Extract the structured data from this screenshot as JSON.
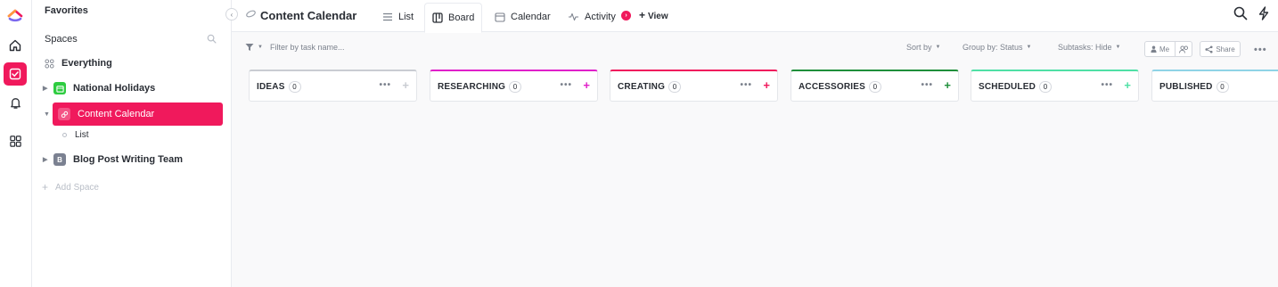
{
  "colors": {
    "accent": "#f0195c",
    "holidays_space": "#2ecc40",
    "blog_space": "#7b8191"
  },
  "rail": {
    "icons": [
      "clickup-logo-icon",
      "home-icon",
      "tasks-icon",
      "bell-icon",
      "apps-grid-icon"
    ]
  },
  "sidebar": {
    "favorites": "Favorites",
    "spaces": "Spaces",
    "everything": "Everything",
    "items": [
      {
        "label": "National Holidays"
      },
      {
        "label": "Content Calendar"
      },
      {
        "label": "Blog Post Writing Team",
        "badge": "B"
      }
    ],
    "list_child": "List",
    "add_space": "Add Space"
  },
  "header": {
    "title": "Content Calendar",
    "tabs": [
      {
        "label": "List"
      },
      {
        "label": "Board"
      },
      {
        "label": "Calendar"
      },
      {
        "label": "Activity"
      }
    ],
    "add_view": "View",
    "active_tab": "Board"
  },
  "toolbar": {
    "filter_placeholder": "Filter by task name...",
    "sort_by": "Sort by",
    "group_by": "Group by: Status",
    "subtasks": "Subtasks: Hide",
    "me": "Me",
    "share": "Share"
  },
  "board": {
    "columns": [
      {
        "name": "IDEAS",
        "count": "0",
        "color": "#c9ccd2"
      },
      {
        "name": "RESEARCHING",
        "count": "0",
        "color": "#e020c9"
      },
      {
        "name": "CREATING",
        "count": "0",
        "color": "#f0195c"
      },
      {
        "name": "ACCESSORIES",
        "count": "0",
        "color": "#1f8f3a"
      },
      {
        "name": "SCHEDULED",
        "count": "0",
        "color": "#4fe0a5"
      },
      {
        "name": "PUBLISHED",
        "count": "0",
        "color": "#8fd3e6"
      }
    ]
  }
}
